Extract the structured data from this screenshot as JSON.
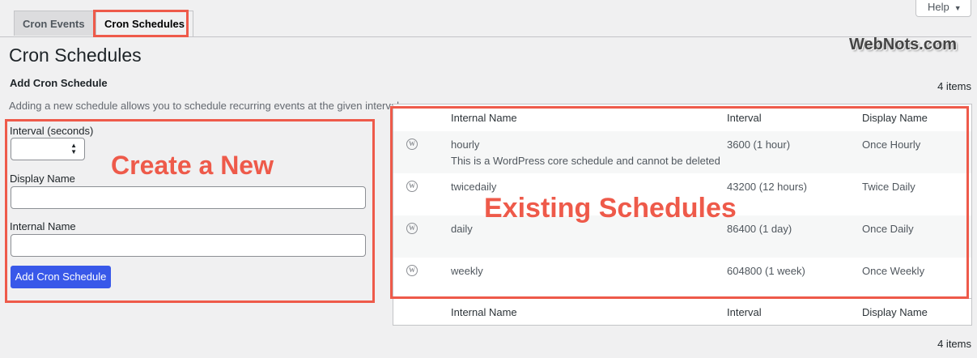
{
  "tabs": [
    {
      "label": "Cron Events",
      "active": false
    },
    {
      "label": "Cron Schedules",
      "active": true
    }
  ],
  "help": {
    "label": "Help",
    "icon": "triangle-down-icon"
  },
  "watermark": "WebNots.com",
  "page_title": "Cron Schedules",
  "form": {
    "title": "Add Cron Schedule",
    "description": "Adding a new schedule allows you to schedule recurring events at the given interval.",
    "interval_label": "Interval (seconds)",
    "interval_value": "",
    "display_name_label": "Display Name",
    "display_name_value": "",
    "internal_name_label": "Internal Name",
    "internal_name_value": "",
    "submit_label": "Add Cron Schedule"
  },
  "table": {
    "count_top": "4 items",
    "count_bottom": "4 items",
    "columns": [
      "Internal Name",
      "Interval",
      "Display Name"
    ],
    "rows": [
      {
        "name": "hourly",
        "interval": "3600 (1 hour)",
        "display": "Once Hourly",
        "note": "This is a WordPress core schedule and cannot be deleted",
        "icon": "wordpress-icon"
      },
      {
        "name": "twicedaily",
        "interval": "43200 (12 hours)",
        "display": "Twice Daily",
        "icon": "wordpress-icon"
      },
      {
        "name": "daily",
        "interval": "86400 (1 day)",
        "display": "Once Daily",
        "icon": "wordpress-icon"
      },
      {
        "name": "weekly",
        "interval": "604800 (1 week)",
        "display": "Once Weekly",
        "icon": "wordpress-icon"
      }
    ]
  },
  "annotations": {
    "create_new": "Create a New",
    "existing": "Existing Schedules"
  },
  "colors": {
    "highlight": "#ee5a4a",
    "primary_button": "#3858e9",
    "background": "#f0f0f1"
  }
}
